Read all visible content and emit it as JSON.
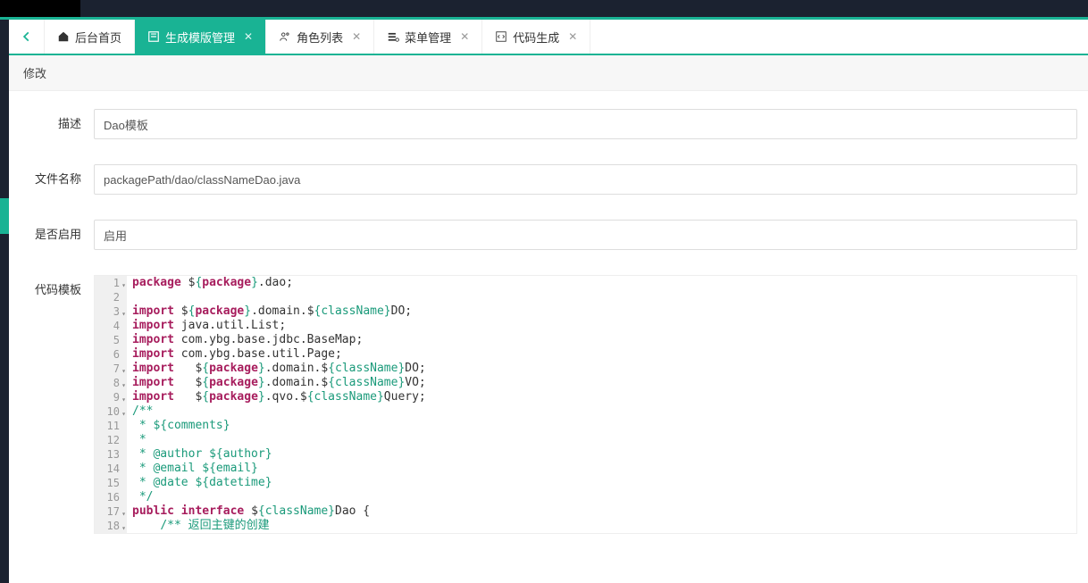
{
  "tabs": {
    "home": "后台首页",
    "t1": "生成模版管理",
    "t2": "角色列表",
    "t3": "菜单管理",
    "t4": "代码生成"
  },
  "panel_title": "修改",
  "labels": {
    "desc": "描述",
    "filename": "文件名称",
    "enabled": "是否启用",
    "code": "代码模板"
  },
  "fields": {
    "desc": "Dao模板",
    "filename": "packagePath/dao/classNameDao.java",
    "enabled": "启用"
  },
  "code": {
    "lines": [
      {
        "n": "1",
        "fold": true,
        "html": "<span class='kw'>package</span> $<span class='var'>{<span class='kw2'>package</span>}</span>.dao;"
      },
      {
        "n": "2",
        "html": ""
      },
      {
        "n": "3",
        "fold": true,
        "html": "<span class='kw'>import</span> $<span class='var'>{<span class='kw2'>package</span>}</span>.domain.$<span class='var'>{className}</span>DO;"
      },
      {
        "n": "4",
        "html": "<span class='kw'>import</span> java.util.List;"
      },
      {
        "n": "5",
        "html": "<span class='kw'>import</span> com.ybg.base.jdbc.BaseMap;"
      },
      {
        "n": "6",
        "html": "<span class='kw'>import</span> com.ybg.base.util.Page;"
      },
      {
        "n": "7",
        "fold": true,
        "html": "<span class='kw'>import</span>   $<span class='var'>{<span class='kw2'>package</span>}</span>.domain.$<span class='var'>{className}</span>DO;"
      },
      {
        "n": "8",
        "fold": true,
        "html": "<span class='kw'>import</span>   $<span class='var'>{<span class='kw2'>package</span>}</span>.domain.$<span class='var'>{className}</span>VO;"
      },
      {
        "n": "9",
        "fold": true,
        "html": "<span class='kw'>import</span>   $<span class='var'>{<span class='kw2'>package</span>}</span>.qvo.$<span class='var'>{className}</span>Query;"
      },
      {
        "n": "10",
        "fold": true,
        "html": "<span class='cmt'>/**</span>"
      },
      {
        "n": "11",
        "html": "<span class='cmt'> * ${comments}</span>"
      },
      {
        "n": "12",
        "html": "<span class='cmt'> *</span>"
      },
      {
        "n": "13",
        "html": "<span class='cmt'> * @author ${author}</span>"
      },
      {
        "n": "14",
        "html": "<span class='cmt'> * @email ${email}</span>"
      },
      {
        "n": "15",
        "html": "<span class='cmt'> * @date ${datetime}</span>"
      },
      {
        "n": "16",
        "html": "<span class='cmt'> */</span>"
      },
      {
        "n": "17",
        "fold": true,
        "html": "<span class='kw'>public</span> <span class='kw'>interface</span> $<span class='var'>{className}</span>Dao {"
      },
      {
        "n": "18",
        "fold": true,
        "html": "    <span class='cmt'>/** 返回主键的创建</span>"
      }
    ]
  }
}
